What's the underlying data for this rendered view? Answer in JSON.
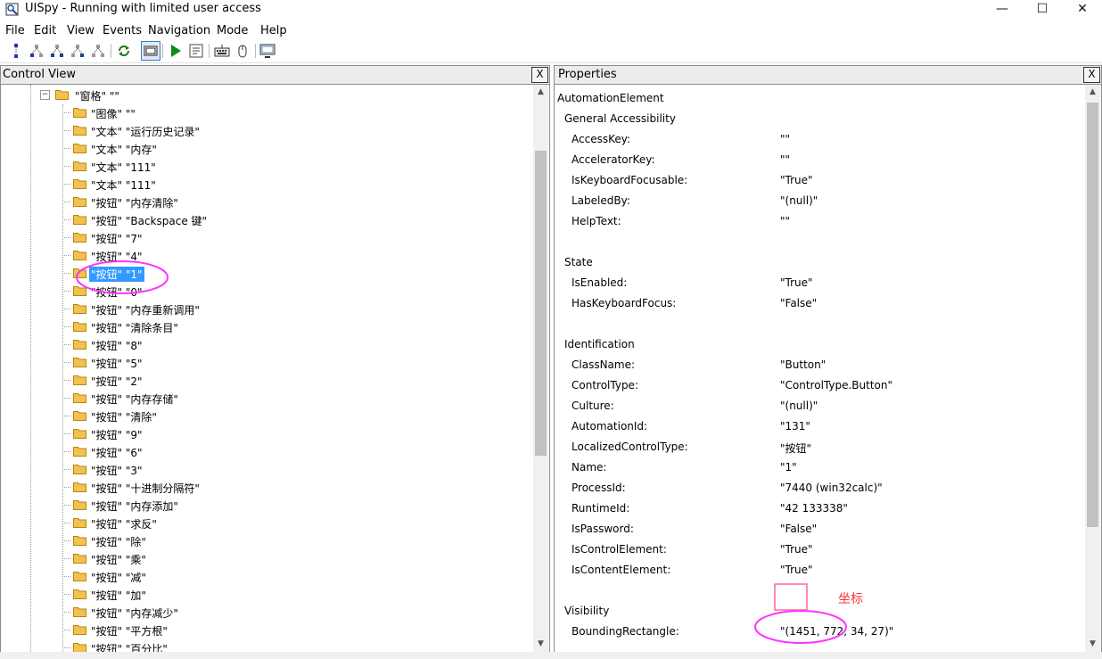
{
  "window": {
    "title": "UISpy - Running with limited user access",
    "minimize": "—",
    "maximize": "☐",
    "close": "✕"
  },
  "menu": [
    "File",
    "Edit",
    "View",
    "Events",
    "Navigation",
    "Mode",
    "Help"
  ],
  "toolbar_icons": [
    "tree-parent-icon",
    "tree-prev-sibling-icon",
    "tree-first-child-icon",
    "tree-next-sibling-icon",
    "tree-last-child-icon",
    "refresh-icon",
    "focus-tracking-icon",
    "play-icon",
    "invoke-pattern-icon",
    "keyboard-icon",
    "hover-mode-icon",
    "screenshot-icon"
  ],
  "control_view": {
    "title": "Control View",
    "close": "X",
    "parent_label": "\"窗格\" \"\"",
    "items": [
      "\"图像\" \"\"",
      "\"文本\" \"运行历史记录\"",
      "\"文本\" \"内存\"",
      "\"文本\" \"111\"",
      "\"文本\" \"111\"",
      "\"按钮\" \"内存清除\"",
      "\"按钮\" \"Backspace 键\"",
      "\"按钮\" \"7\"",
      "\"按钮\" \"4\"",
      "\"按钮\" \"1\"",
      "\"按钮\" \"0\"",
      "\"按钮\" \"内存重新调用\"",
      "\"按钮\" \"清除条目\"",
      "\"按钮\" \"8\"",
      "\"按钮\" \"5\"",
      "\"按钮\" \"2\"",
      "\"按钮\" \"内存存储\"",
      "\"按钮\" \"清除\"",
      "\"按钮\" \"9\"",
      "\"按钮\" \"6\"",
      "\"按钮\" \"3\"",
      "\"按钮\" \"十进制分隔符\"",
      "\"按钮\" \"内存添加\"",
      "\"按钮\" \"求反\"",
      "\"按钮\" \"除\"",
      "\"按钮\" \"乘\"",
      "\"按钮\" \"减\"",
      "\"按钮\" \"加\"",
      "\"按钮\" \"内存减少\"",
      "\"按钮\" \"平方根\"",
      "\"按钮\" \"百分比\""
    ],
    "selected_index": 9
  },
  "properties": {
    "title": "Properties",
    "close": "X",
    "root": "AutomationElement",
    "sections": [
      {
        "name": "General Accessibility",
        "rows": [
          [
            "AccessKey:",
            "\"\""
          ],
          [
            "AcceleratorKey:",
            "\"\""
          ],
          [
            "IsKeyboardFocusable:",
            "\"True\""
          ],
          [
            "LabeledBy:",
            "\"(null)\""
          ],
          [
            "HelpText:",
            "\"\""
          ]
        ]
      },
      {
        "name": "State",
        "rows": [
          [
            "IsEnabled:",
            "\"True\""
          ],
          [
            "HasKeyboardFocus:",
            "\"False\""
          ]
        ]
      },
      {
        "name": "Identification",
        "rows": [
          [
            "ClassName:",
            "\"Button\""
          ],
          [
            "ControlType:",
            "\"ControlType.Button\""
          ],
          [
            "Culture:",
            "\"(null)\""
          ],
          [
            "AutomationId:",
            "\"131\""
          ],
          [
            "LocalizedControlType:",
            "\"按钮\""
          ],
          [
            "Name:",
            "\"1\""
          ],
          [
            "ProcessId:",
            "\"7440 (win32calc)\""
          ],
          [
            "RuntimeId:",
            "\"42 133338\""
          ],
          [
            "IsPassword:",
            "\"False\""
          ],
          [
            "IsControlElement:",
            "\"True\""
          ],
          [
            "IsContentElement:",
            "\"True\""
          ]
        ]
      },
      {
        "name": "Visibility",
        "rows": [
          [
            "BoundingRectangle:",
            "\"(1451, 772, 34, 27)\""
          ]
        ]
      }
    ],
    "annotation": "坐标"
  },
  "colors": {
    "selection": "#3399ff",
    "annotation": "#ff33ff",
    "annotation_text": "#ff3333",
    "folder": "#f2c14e"
  }
}
